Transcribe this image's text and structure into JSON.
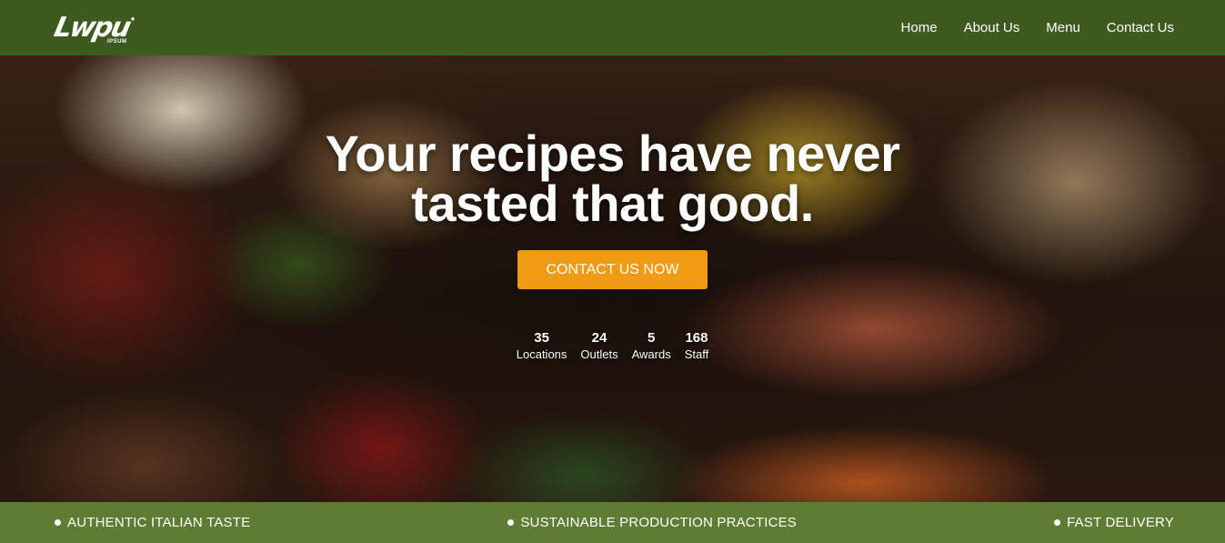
{
  "header": {
    "logo": {
      "mark": "Lwpu",
      "sub": "IPSUM",
      "icon": "logo-icon"
    },
    "nav": [
      {
        "label": "Home"
      },
      {
        "label": "About Us"
      },
      {
        "label": "Menu"
      },
      {
        "label": "Contact Us"
      }
    ]
  },
  "hero": {
    "headline_line1": "Your recipes have never",
    "headline_line2": "tasted that good.",
    "cta_label": "CONTACT US NOW",
    "stats": [
      {
        "value": "35",
        "label": "Locations"
      },
      {
        "value": "24",
        "label": "Outlets"
      },
      {
        "value": "5",
        "label": "Awards"
      },
      {
        "value": "168",
        "label": "Staff"
      }
    ]
  },
  "features": [
    {
      "label": "AUTHENTIC ITALIAN TASTE",
      "icon": "bullet-icon"
    },
    {
      "label": "SUSTAINABLE PRODUCTION PRACTICES",
      "icon": "bullet-icon"
    },
    {
      "label": "FAST DELIVERY",
      "icon": "bullet-icon"
    }
  ],
  "colors": {
    "navbar": "#3e5a1f",
    "features_bar": "#5f7c34",
    "cta": "#f19b12",
    "text": "#ffffff"
  }
}
